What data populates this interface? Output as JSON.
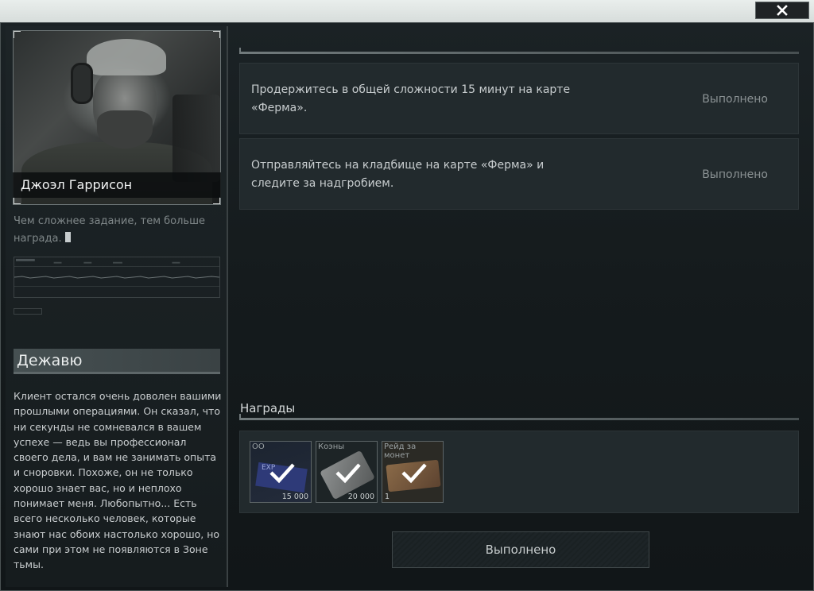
{
  "window": {
    "close_icon": "close-x-icon"
  },
  "trader": {
    "name": "Джоэл Гаррисон",
    "quote": "Чем сложнее задание, тем больше награда."
  },
  "quest": {
    "title": "Дежавю",
    "description": "Клиент остался очень доволен вашими прошлыми операциями. Он сказал, что ни секунды не сомневался в вашем успехе — ведь вы профессионал своего дела, и вам не занимать опыта и сноровки. Похоже, он не только хорошо знает вас, но и неплохо понимает меня. Любопытно... Есть всего несколько человек, которые знают нас обоих настолько хорошо, но сами при этом не появляются в Зоне тьмы."
  },
  "objectives": [
    {
      "text": "Продержитесь в общей сложности 15 минут на карте «Ферма».",
      "status": "Выполнено"
    },
    {
      "text": "Отправляйтесь на кладбище на карте «Ферма» и следите за надгробием.",
      "status": "Выполнено"
    }
  ],
  "rewards": {
    "label": "Награды",
    "items": [
      {
        "name": "ОО",
        "art_text": "EXP",
        "count": "15 000",
        "icon": "experience-icon"
      },
      {
        "name": "Коэны",
        "count": "20 000",
        "icon": "coins-icon"
      },
      {
        "name": "Рейд за монет",
        "count": "1",
        "icon": "raid-ticket-icon"
      }
    ]
  },
  "complete_button": {
    "label": "Выполнено"
  },
  "colors": {
    "accent": "#ffffff",
    "panel": "#222a2d",
    "text": "#c8cdcf",
    "status": "#8b9294"
  }
}
